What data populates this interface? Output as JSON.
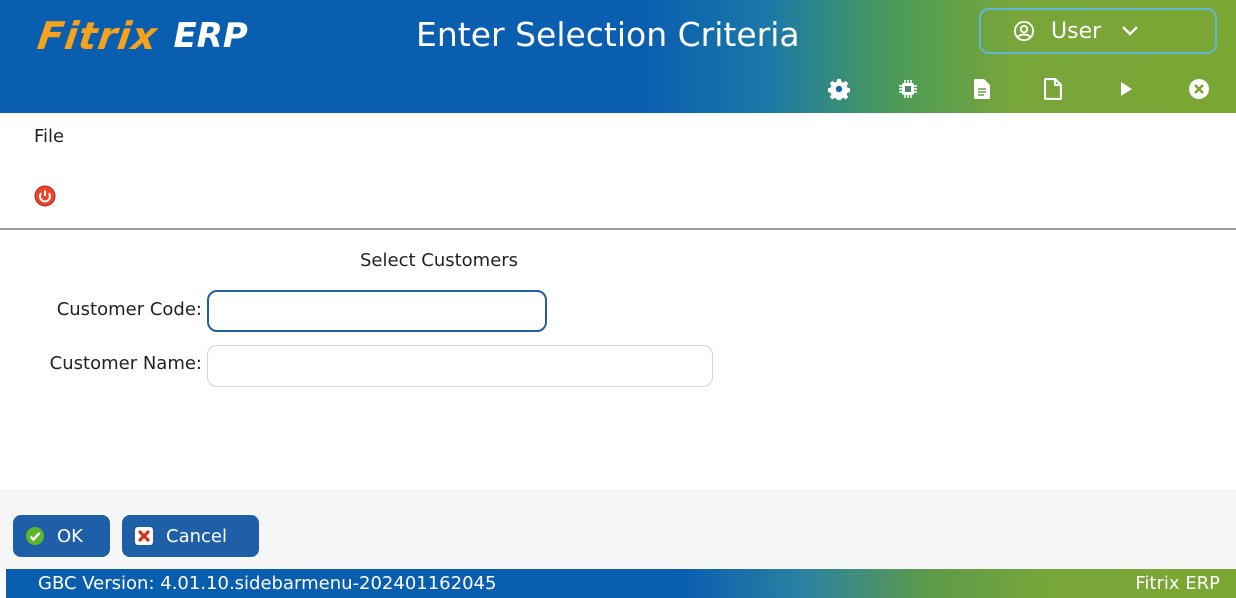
{
  "header": {
    "logo_primary": "Fitrix",
    "logo_secondary": "ERP",
    "title": "Enter Selection Criteria",
    "user_label": "User",
    "toolbar_icons": [
      "gear-icon",
      "chip-icon",
      "document-text-icon",
      "document-icon",
      "play-icon",
      "close-circle-icon"
    ]
  },
  "menu": {
    "file_label": "File",
    "quit_icon": "power-icon"
  },
  "form": {
    "title": "Select Customers",
    "customer_code_label": "Customer Code:",
    "customer_code_value": "",
    "customer_name_label": "Customer Name:",
    "customer_name_value": ""
  },
  "buttons": {
    "ok_label": "OK",
    "cancel_label": "Cancel"
  },
  "status": {
    "version_text": "GBC Version: 4.01.10.sidebarmenu-202401162045",
    "brand_text": "Fitrix ERP"
  },
  "colors": {
    "primary_blue": "#0a5eb0",
    "accent_green": "#7aa632",
    "logo_orange": "#f7a21b",
    "button_blue": "#1f5fa8"
  }
}
